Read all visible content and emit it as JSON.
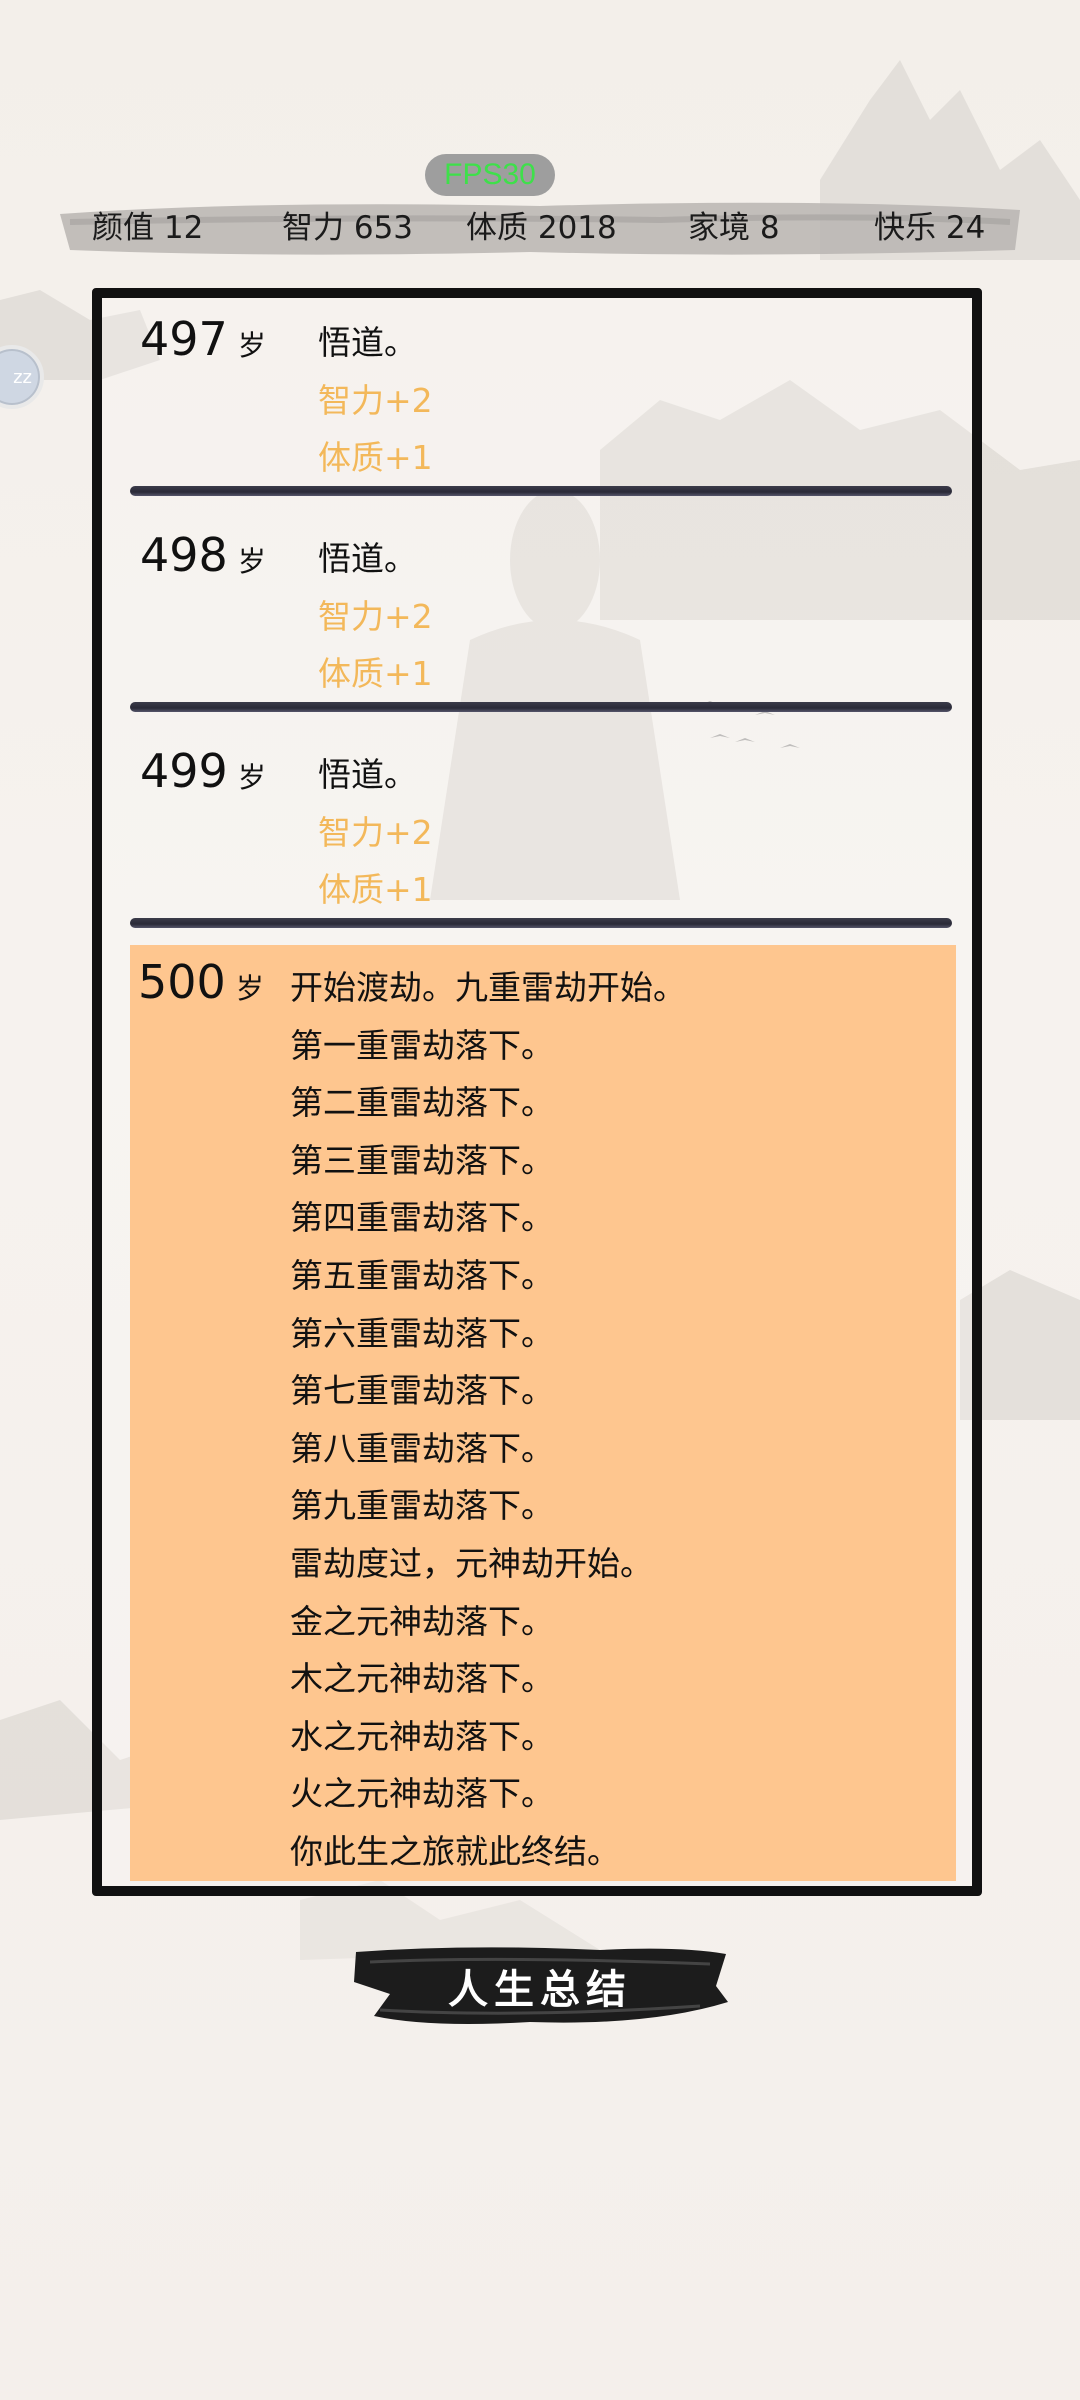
{
  "fps_label": "FPS30",
  "stats": [
    {
      "label": "颜值 12"
    },
    {
      "label": "智力 653"
    },
    {
      "label": "体质 2018"
    },
    {
      "label": "家境 8"
    },
    {
      "label": "快乐 24"
    }
  ],
  "side_bubble": "zz",
  "entries": [
    {
      "age": "497",
      "unit": "岁",
      "lines": [
        "悟道。"
      ],
      "gains": [
        "智力+2",
        "体质+1"
      ]
    },
    {
      "age": "498",
      "unit": "岁",
      "lines": [
        "悟道。"
      ],
      "gains": [
        "智力+2",
        "体质+1"
      ]
    },
    {
      "age": "499",
      "unit": "岁",
      "lines": [
        "悟道。"
      ],
      "gains": [
        "智力+2",
        "体质+1"
      ]
    },
    {
      "age": "500",
      "unit": "岁",
      "lines": [
        "开始渡劫。九重雷劫开始。",
        "第一重雷劫落下。",
        "第二重雷劫落下。",
        "第三重雷劫落下。",
        "第四重雷劫落下。",
        "第五重雷劫落下。",
        "第六重雷劫落下。",
        "第七重雷劫落下。",
        "第八重雷劫落下。",
        "第九重雷劫落下。",
        "雷劫度过，元神劫开始。",
        "金之元神劫落下。",
        "木之元神劫落下。",
        "水之元神劫落下。",
        "火之元神劫落下。",
        "你此生之旅就此终结。"
      ]
    }
  ],
  "summary_button": "人生总结",
  "colors": {
    "gain": "#f3b85a",
    "final_highlight": "#fec68f",
    "fps_text": "#3ee04a"
  }
}
